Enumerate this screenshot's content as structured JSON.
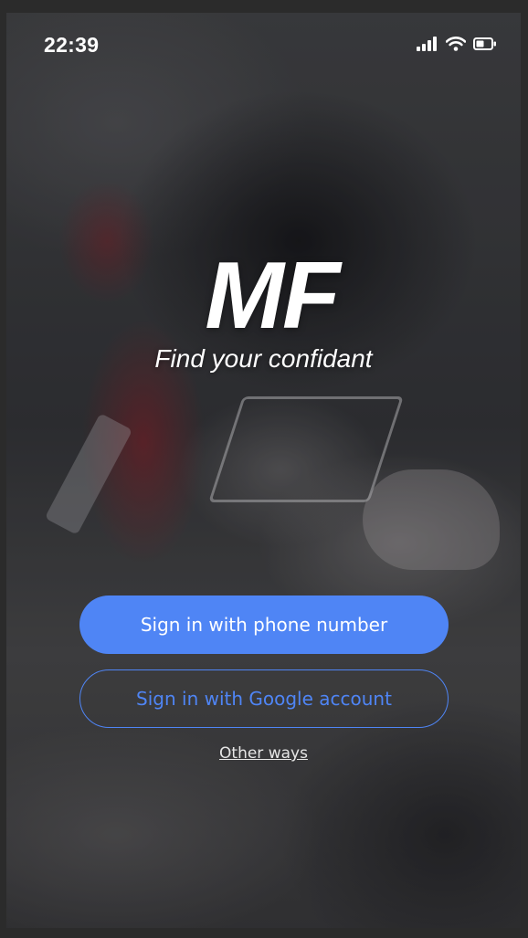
{
  "status_bar": {
    "time": "22:39",
    "icons": [
      "signal-icon",
      "wifi-icon",
      "battery-icon"
    ]
  },
  "brand": {
    "logo": "MF",
    "tagline": "Find your confidant"
  },
  "actions": {
    "phone_label": "Sign in with phone number",
    "google_label": "Sign in with Google account",
    "other_label": "Other ways"
  },
  "colors": {
    "accent": "#4f85f5",
    "text": "#ffffff"
  }
}
